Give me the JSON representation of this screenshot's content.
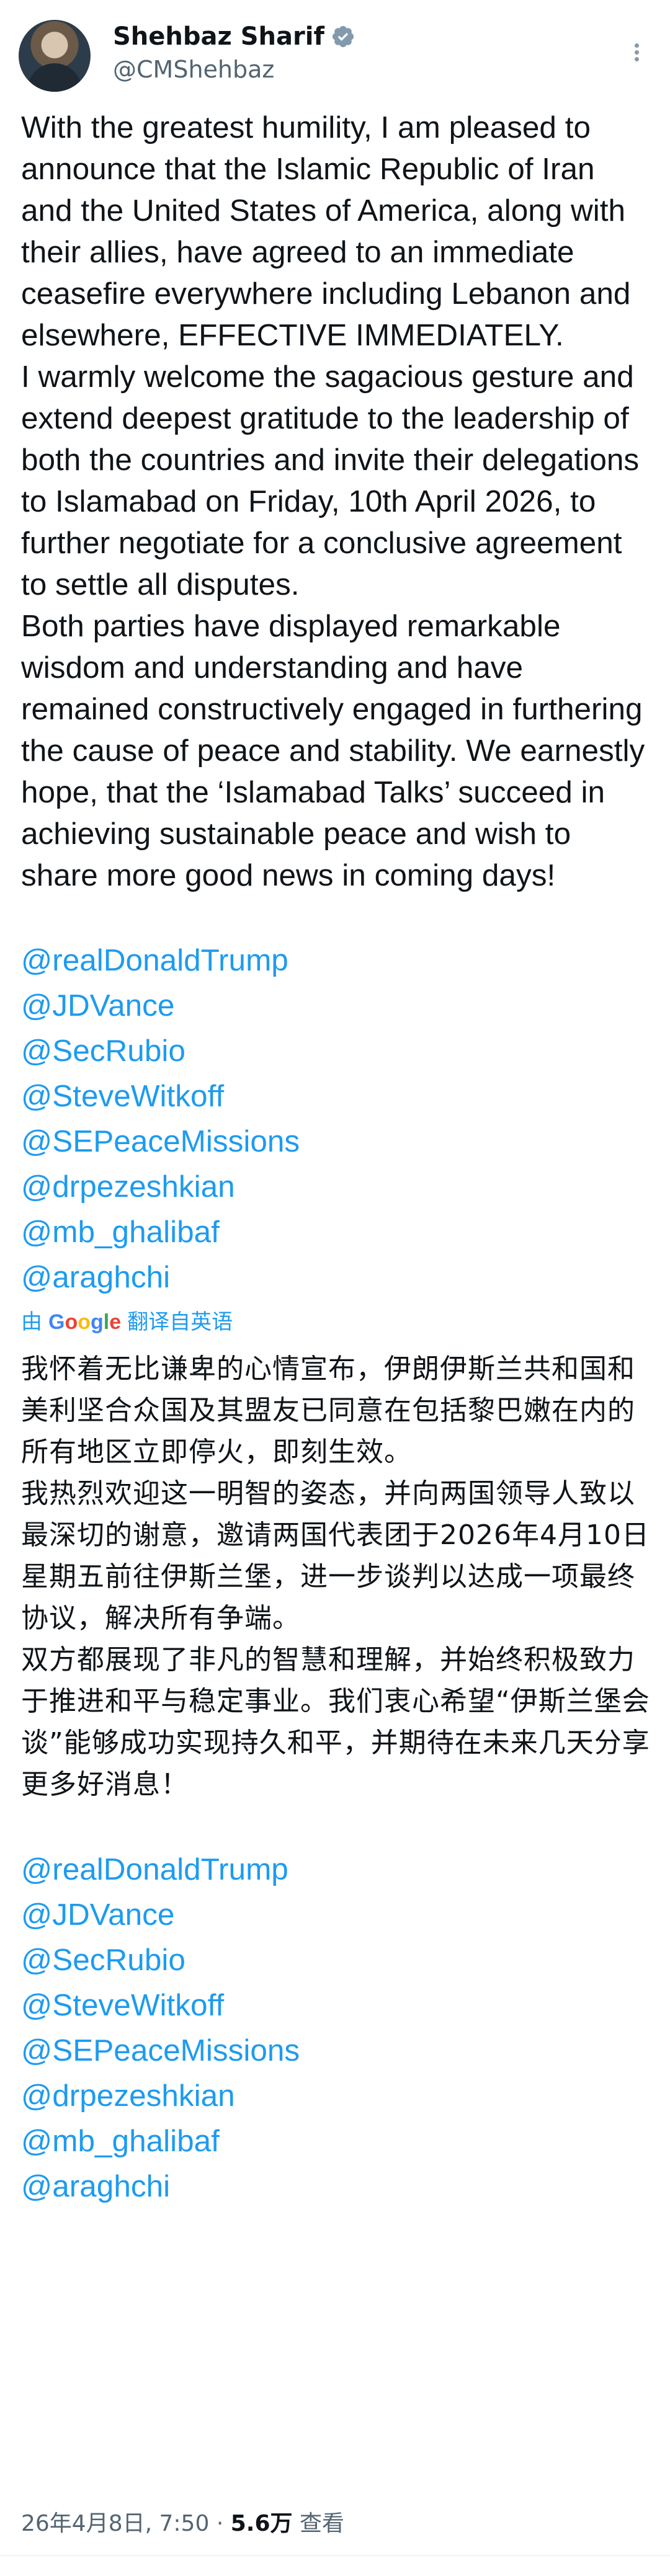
{
  "author": {
    "name": "Shehbaz Sharif",
    "handle": "@CMShehbaz"
  },
  "body": {
    "paragraphs": [
      "With the greatest humility, I am pleased to announce that the Islamic Republic of Iran and the United States of America, along with their allies, have agreed to an immediate ceasefire everywhere including Lebanon and elsewhere, EFFECTIVE IMMEDIATELY.",
      "I warmly welcome the sagacious gesture and extend deepest gratitude to the leadership of both the countries and invite their delegations to Islamabad on Friday, 10th April 2026, to further negotiate for a conclusive agreement to settle all disputes.",
      "Both parties have displayed remarkable wisdom and understanding and have remained constructively engaged in furthering the cause of peace and stability. We earnestly hope, that the ‘Islamabad Talks’ succeed in achieving sustainable peace and wish to share more good news in coming days!"
    ],
    "mentions": [
      "@realDonaldTrump",
      "@JDVance",
      "@SecRubio",
      "@SteveWitkoff",
      "@SEPeaceMissions",
      "@drpezeshkian",
      "@mb_ghalibaf",
      "@araghchi"
    ]
  },
  "translation": {
    "by": "由",
    "google": "Google",
    "label": "翻译自英语",
    "paragraphs": [
      "我怀着无比谦卑的心情宣布，伊朗伊斯兰共和国和美利坚合众国及其盟友已同意在包括黎巴嫩在内的所有地区立即停火，即刻生效。",
      "我热烈欢迎这一明智的姿态，并向两国领导人致以最深切的谢意，邀请两国代表团于2026年4月10日星期五前往伊斯兰堡，进一步谈判以达成一项最终协议，解决所有争端。",
      "双方都展现了非凡的智慧和理解，并始终积极致力于推进和平与稳定事业。我们衷心希望“伊斯兰堡会谈”能够成功实现持久和平，并期待在未来几天分享更多好消息！"
    ],
    "mentions": [
      "@realDonaldTrump",
      "@JDVance",
      "@SecRubio",
      "@SteveWitkoff",
      "@SEPeaceMissions",
      "@drpezeshkian",
      "@mb_ghalibaf",
      "@araghchi"
    ]
  },
  "meta": {
    "timestamp": "26年4月8日, 7:50",
    "separator": "·",
    "views_count": "5.6万",
    "views_label": "查看"
  },
  "colors": {
    "link": "#1d9bf0",
    "text": "#0f1419",
    "secondary": "#536471"
  }
}
